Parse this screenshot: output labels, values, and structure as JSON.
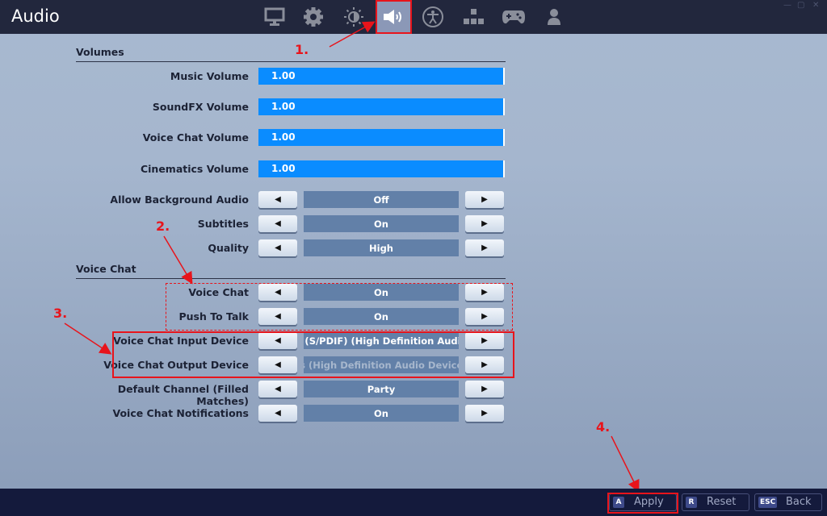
{
  "header": {
    "title": "Audio",
    "tabs": [
      {
        "icon": "monitor-icon",
        "label": "Video",
        "active": false
      },
      {
        "icon": "gear-icon",
        "label": "Game",
        "active": false
      },
      {
        "icon": "brightness-icon",
        "label": "Brightness",
        "active": false
      },
      {
        "icon": "speaker-icon",
        "label": "Audio",
        "active": true
      },
      {
        "icon": "accessibility-icon",
        "label": "Accessibility",
        "active": false
      },
      {
        "icon": "input-keys-icon",
        "label": "Input",
        "active": false
      },
      {
        "icon": "gamepad-icon",
        "label": "Controller",
        "active": false
      },
      {
        "icon": "account-icon",
        "label": "Account",
        "active": false
      }
    ],
    "window_controls": {
      "minimize": "—",
      "maximize": "▢",
      "close": "✕"
    }
  },
  "sections": {
    "volumes": {
      "title": "Volumes",
      "sliders": [
        {
          "label": "Music Volume",
          "value": "1.00",
          "fraction": 1.0
        },
        {
          "label": "SoundFX Volume",
          "value": "1.00",
          "fraction": 1.0
        },
        {
          "label": "Voice Chat Volume",
          "value": "1.00",
          "fraction": 1.0
        },
        {
          "label": "Cinematics Volume",
          "value": "1.00",
          "fraction": 1.0
        }
      ],
      "options": [
        {
          "label": "Allow Background Audio",
          "value": "Off"
        },
        {
          "label": "Subtitles",
          "value": "On"
        },
        {
          "label": "Quality",
          "value": "High"
        }
      ]
    },
    "voice_chat": {
      "title": "Voice Chat",
      "options": [
        {
          "label": "Voice Chat",
          "value": "On"
        },
        {
          "label": "Push To Talk",
          "value": "On"
        },
        {
          "label": "Voice Chat Input Device",
          "value": "o (S/PDIF) (High Definition Audio"
        },
        {
          "label": "Voice Chat Output Device",
          "value": "rs (High Definition Audio Device)"
        },
        {
          "label": "Default Channel (Filled Matches)",
          "value": "Party"
        },
        {
          "label": "Voice Chat Notifications",
          "value": "On"
        }
      ]
    }
  },
  "arrows": {
    "left": "◀",
    "right": "▶"
  },
  "footer": {
    "apply": {
      "key": "A",
      "label": "Apply"
    },
    "reset": {
      "key": "R",
      "label": "Reset"
    },
    "back": {
      "key": "ESC",
      "label": "Back"
    }
  },
  "annotations": {
    "a1": "1.",
    "a2": "2.",
    "a3": "3.",
    "a4": "4."
  },
  "colors": {
    "accent": "#0a8cff",
    "annotation": "#e8141b",
    "topbar": "#22273d"
  }
}
